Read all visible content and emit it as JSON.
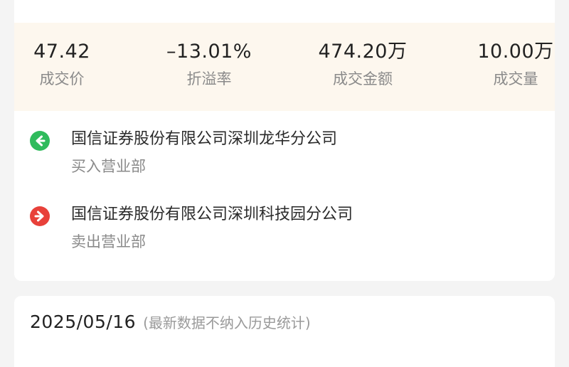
{
  "stats": [
    {
      "value": "47.42",
      "label": "成交价"
    },
    {
      "value": "–13.01%",
      "label": "折溢率"
    },
    {
      "value": "474.20万",
      "label": "成交金额"
    },
    {
      "value": "10.00万",
      "label": "成交量"
    }
  ],
  "buyer": {
    "name": "国信证券股份有限公司深圳龙华分公司",
    "role": "买入营业部",
    "icon": "arrow-left-icon",
    "color": "#2fbb5c"
  },
  "seller": {
    "name": "国信证券股份有限公司深圳科技园分公司",
    "role": "卖出营业部",
    "icon": "arrow-right-icon",
    "color": "#e8413a"
  },
  "next_record": {
    "date": "2025/05/16",
    "note": "(最新数据不纳入历史统计)"
  }
}
